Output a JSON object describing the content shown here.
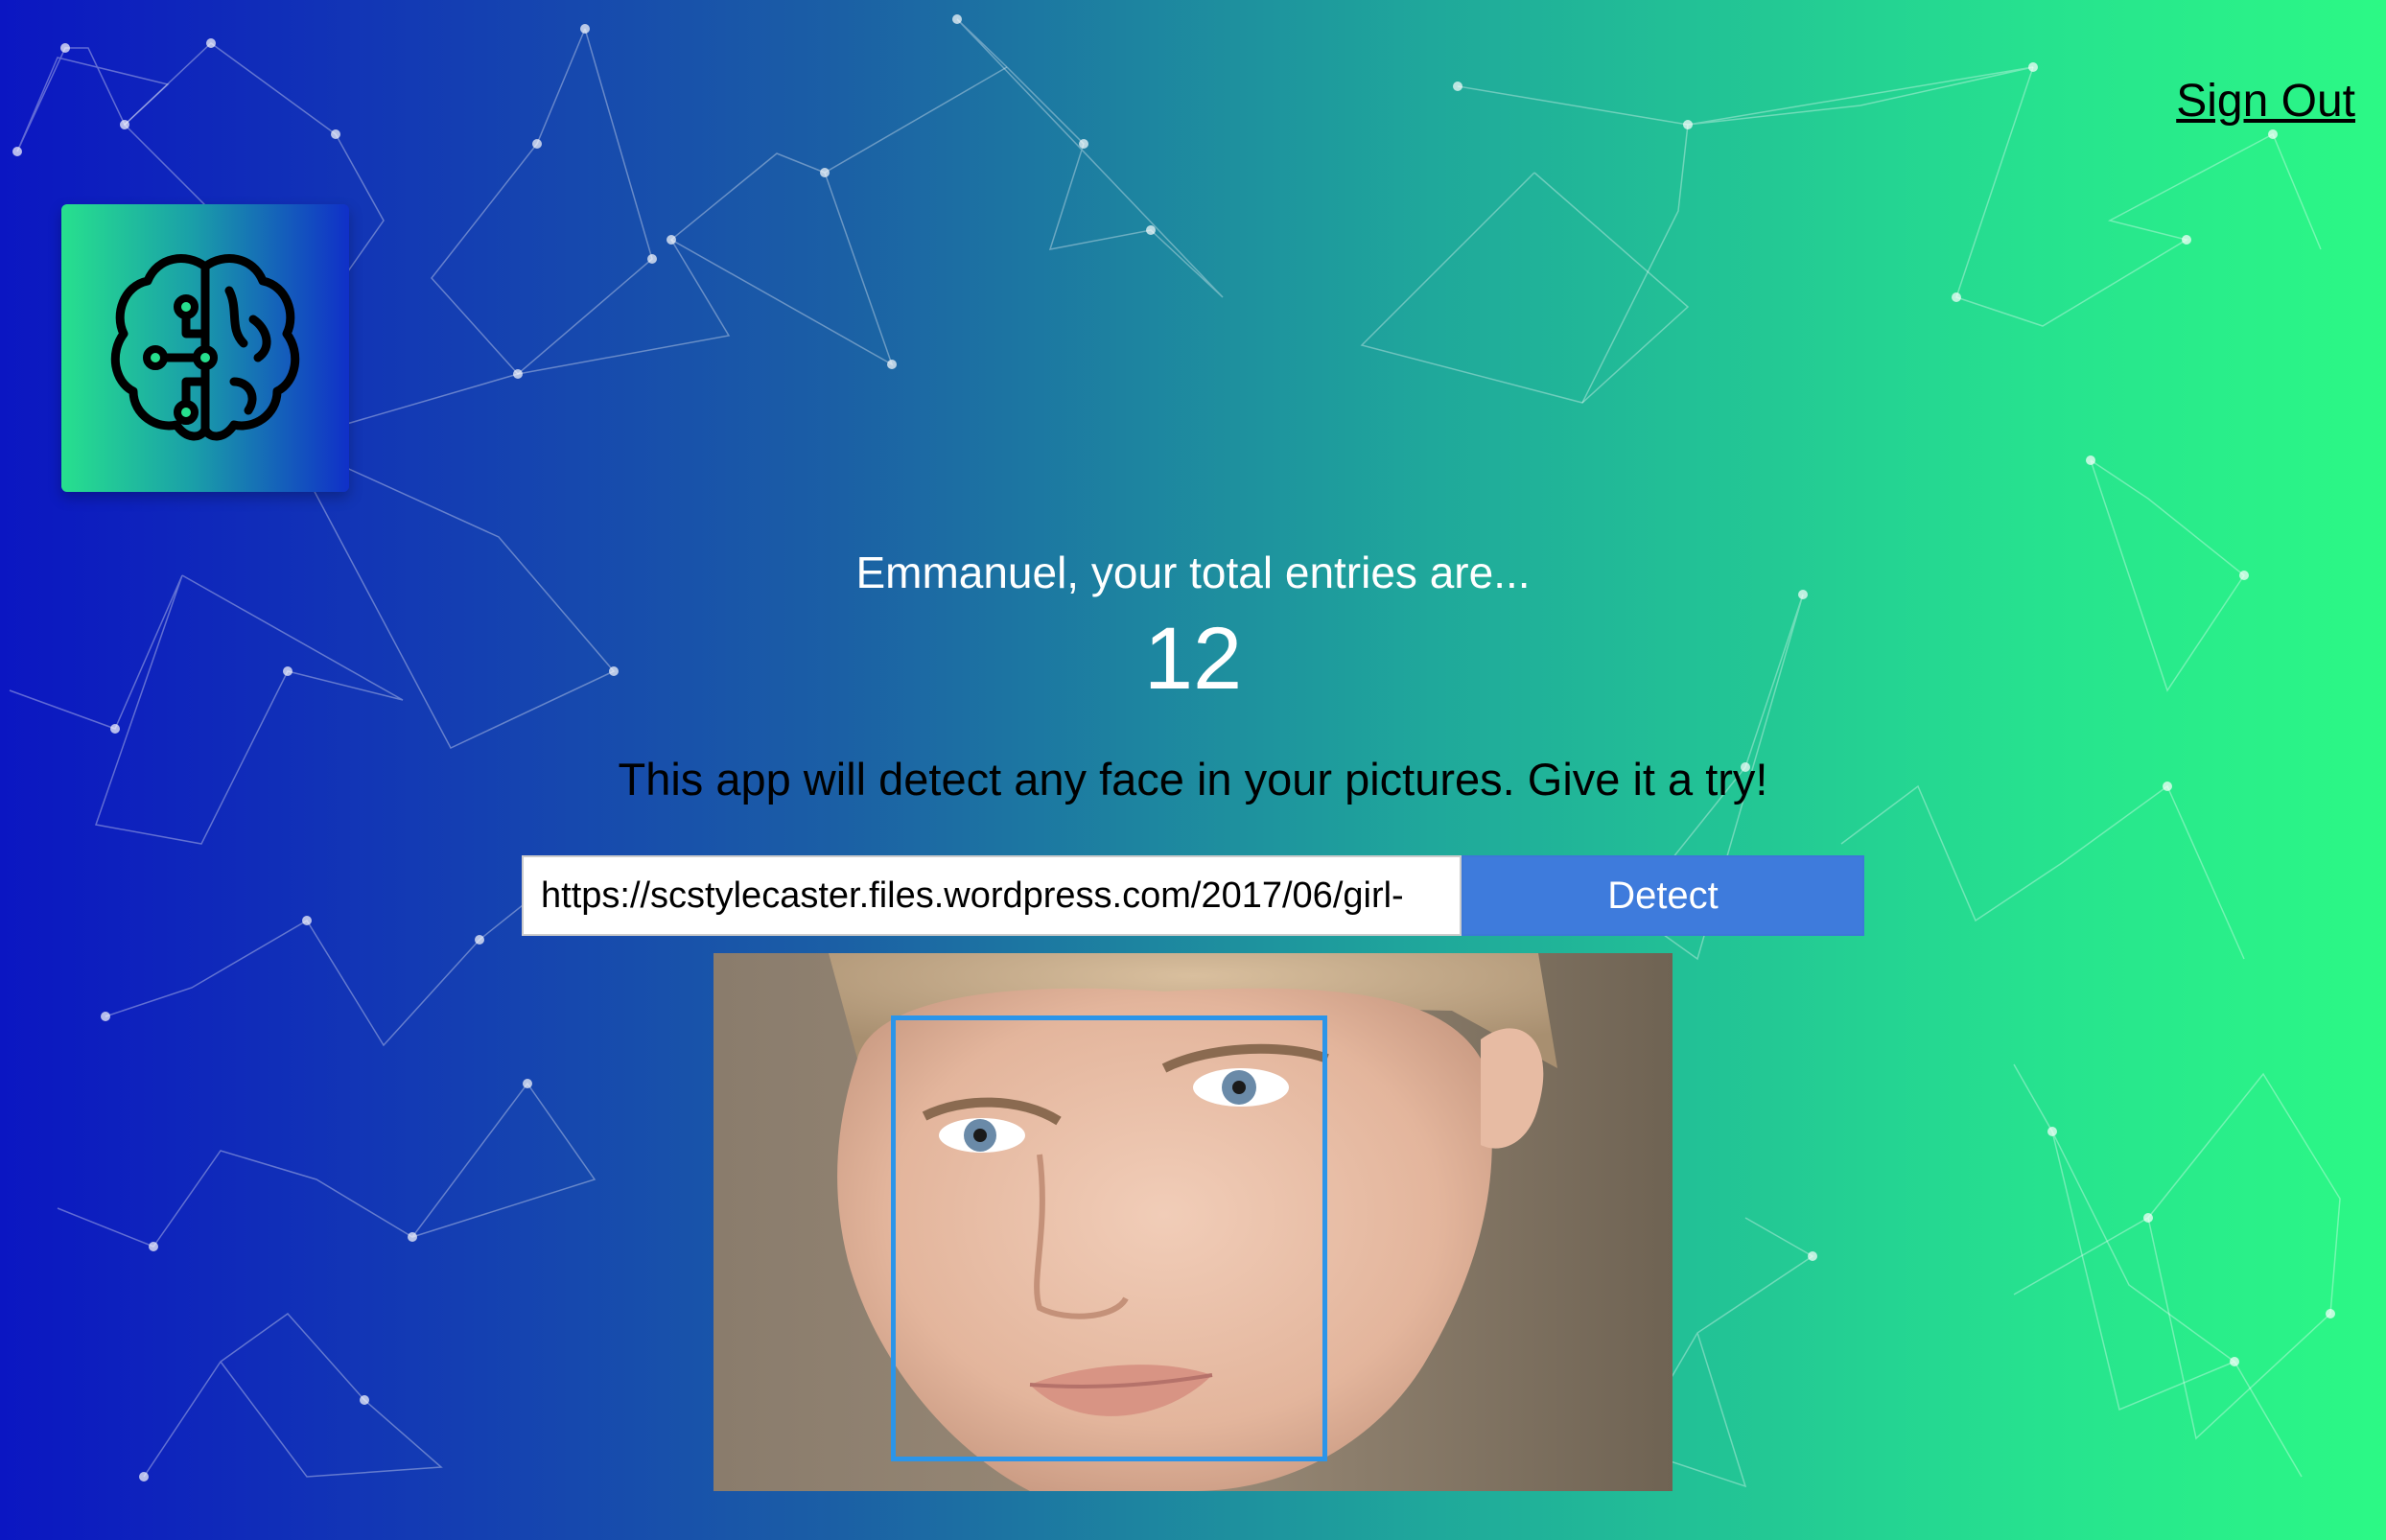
{
  "header": {
    "sign_out_label": "Sign Out",
    "logo_icon": "brain-circuit-icon"
  },
  "rank": {
    "entries_line": "Emmanuel, your total entries are...",
    "count": "12"
  },
  "tagline": "This app will detect any face in your pictures. Give it a try!",
  "image_form": {
    "url_value": "https://scstylecaster.files.wordpress.com/2017/06/girl-",
    "detect_label": "Detect"
  },
  "result": {
    "image_subject": "face photo",
    "box_color": "#2b95e9"
  },
  "colors": {
    "gradient_left": "#0b16c2",
    "gradient_right": "#2cf985",
    "button_bg": "#3e7bdc"
  }
}
